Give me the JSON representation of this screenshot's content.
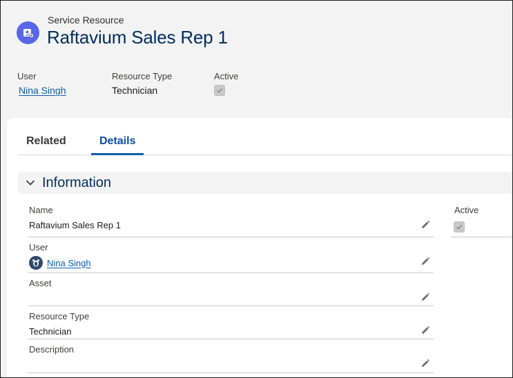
{
  "header": {
    "object_label": "Service Resource",
    "title": "Raftavium Sales Rep 1",
    "icon": "service-resource-icon"
  },
  "highlights": {
    "user_label": "User",
    "user_value": "Nina Singh",
    "resource_type_label": "Resource Type",
    "resource_type_value": "Technician",
    "active_label": "Active",
    "active_checked": true
  },
  "tabs": [
    {
      "label": "Related",
      "active": false
    },
    {
      "label": "Details",
      "active": true
    }
  ],
  "section": {
    "title": "Information",
    "expanded": true
  },
  "fields": {
    "name_label": "Name",
    "name_value": "Raftavium Sales Rep 1",
    "user_label": "User",
    "user_value": "Nina Singh",
    "asset_label": "Asset",
    "asset_value": "",
    "resource_type_label": "Resource Type",
    "resource_type_value": "Technician",
    "description_label": "Description",
    "description_value": "",
    "active_label": "Active",
    "active_checked": true
  },
  "colors": {
    "brand_icon": "#5867e8",
    "title": "#032d60",
    "link": "#0b5cab",
    "active_tab": "#0b4ca7"
  }
}
